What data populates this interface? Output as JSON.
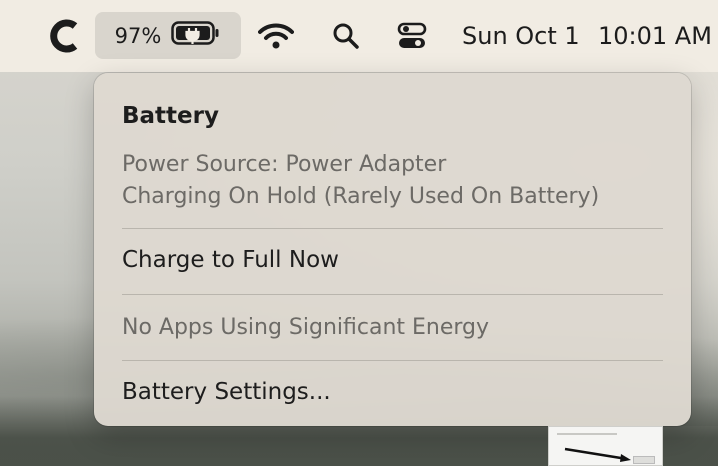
{
  "menubar": {
    "app_icon": "c-app-icon",
    "battery_percent": "97%",
    "battery_icon": "battery-charging-icon",
    "wifi_icon": "wifi-icon",
    "search_icon": "search-icon",
    "control_center_icon": "control-center-icon",
    "date": "Sun Oct 1",
    "time": "10:01 AM"
  },
  "battery_menu": {
    "title": "Battery",
    "power_source": "Power Source: Power Adapter",
    "charging_status": "Charging On Hold (Rarely Used On Battery)",
    "charge_full_label": "Charge to Full Now",
    "energy_status": "No Apps Using Significant Energy",
    "settings_label": "Battery Settings..."
  },
  "colors": {
    "menubar_bg": "#f1ece3",
    "menu_bg": "#ded9d0",
    "primary_text": "#1d1d1d",
    "secondary_text": "#6c6a66"
  }
}
